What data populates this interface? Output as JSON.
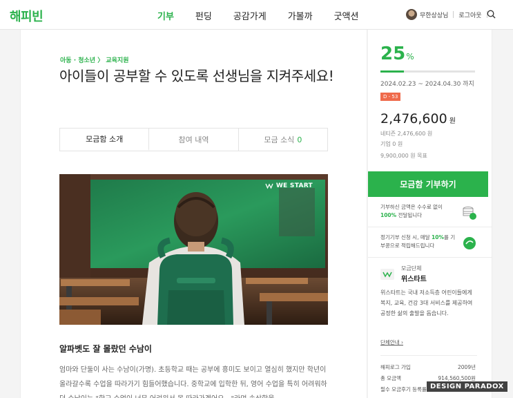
{
  "header": {
    "logo": "해피빈",
    "nav": [
      "기부",
      "펀딩",
      "공감가게",
      "가볼까",
      "굿액션"
    ],
    "user_name": "무한상상님",
    "logout": "로그아웃"
  },
  "campaign": {
    "category": "아동 · 청소년 〉 교육지원",
    "title": "아이들이 공부할 수 있도록 선생님을 지켜주세요!",
    "tabs": [
      {
        "label": "모금함 소개",
        "count": ""
      },
      {
        "label": "참여 내역",
        "count": ""
      },
      {
        "label": "모금 소식",
        "count": "0"
      }
    ],
    "image_watermark": "WE START",
    "subheading": "알파벳도 잘 몰랐던 수남이",
    "story": "엄마와 단둘이 사는 수남이(가명). 초등학교 때는 공부에 흥미도 보이고 열심히 했지만 학년이 올라갈수록 수업을 따라가기 힘들어했습니다. 중학교에 입학한 뒤, 영어 수업을 특히 어려워하던 수남이는 \"학교 수업이 너무 어려워서 못 따라가겠어요…\"라며 속상함을"
  },
  "sidebar": {
    "percent": "25",
    "percent_unit": "%",
    "progress_fraction": 0.25,
    "period": "2024.02.23 ~ 2024.04.30 까지",
    "dday": "D - 53",
    "amount": "2,476,600",
    "amount_unit": "원",
    "netizen": "네티즌 2,476,600 원",
    "company": "기업 0 원",
    "goal": "9,900,000 원 목표",
    "donate_button": "모금함 기부하기",
    "info1_pre": "기부하신 금액은 수수료 없이",
    "info1_bold": "100%",
    "info1_post": " 전달됩니다",
    "info2_pre": "정기기부 신청 시, 매달 ",
    "info2_bold": "10%",
    "info2_post": "를 기부콩으로 적립해드립니다",
    "org_label": "모금단체",
    "org_name": "위스타트",
    "org_desc": "위스타트는 국내 저소득층 어린이들에게 복지, 교육, 건강 3대 서비스를 제공하여 공정한 삶의 출발을 돕습니다.",
    "org_link": "단체안내 ›",
    "stats": [
      {
        "label": "해피로그 가입",
        "value": "2009년"
      },
      {
        "label": "총 모금액",
        "value": "914,560,500원"
      },
      {
        "label": "필수 모금후기 등록률",
        "value": ""
      }
    ]
  },
  "watermark": "DESIGN PARADOX",
  "colors": {
    "accent": "#2bb24c",
    "dday": "#ef6a4b"
  }
}
